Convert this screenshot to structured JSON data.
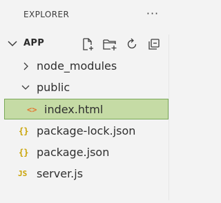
{
  "panel": {
    "title": "EXPLORER",
    "more_icon_label": "···"
  },
  "section": {
    "title": "APP",
    "actions": [
      {
        "name": "new-file-icon"
      },
      {
        "name": "new-folder-icon"
      },
      {
        "name": "refresh-icon"
      },
      {
        "name": "collapse-all-icon"
      }
    ]
  },
  "tree": {
    "items": [
      {
        "label": "node_modules",
        "type": "folder",
        "expanded": false
      },
      {
        "label": "public",
        "type": "folder",
        "expanded": true
      },
      {
        "label": "index.html",
        "type": "html-file",
        "icon_text": "<>",
        "selected": true
      },
      {
        "label": "package-lock.json",
        "type": "json-file",
        "icon_text": "{}"
      },
      {
        "label": "package.json",
        "type": "json-file",
        "icon_text": "{}"
      },
      {
        "label": "server.js",
        "type": "js-file",
        "icon_text": "JS"
      }
    ]
  },
  "colors": {
    "background": "#f3f3f3",
    "selection": "#c5dba5",
    "selection_border": "#7aa858",
    "html_icon": "#e37933",
    "json_icon": "#c9a200",
    "js_icon": "#c9a200"
  }
}
